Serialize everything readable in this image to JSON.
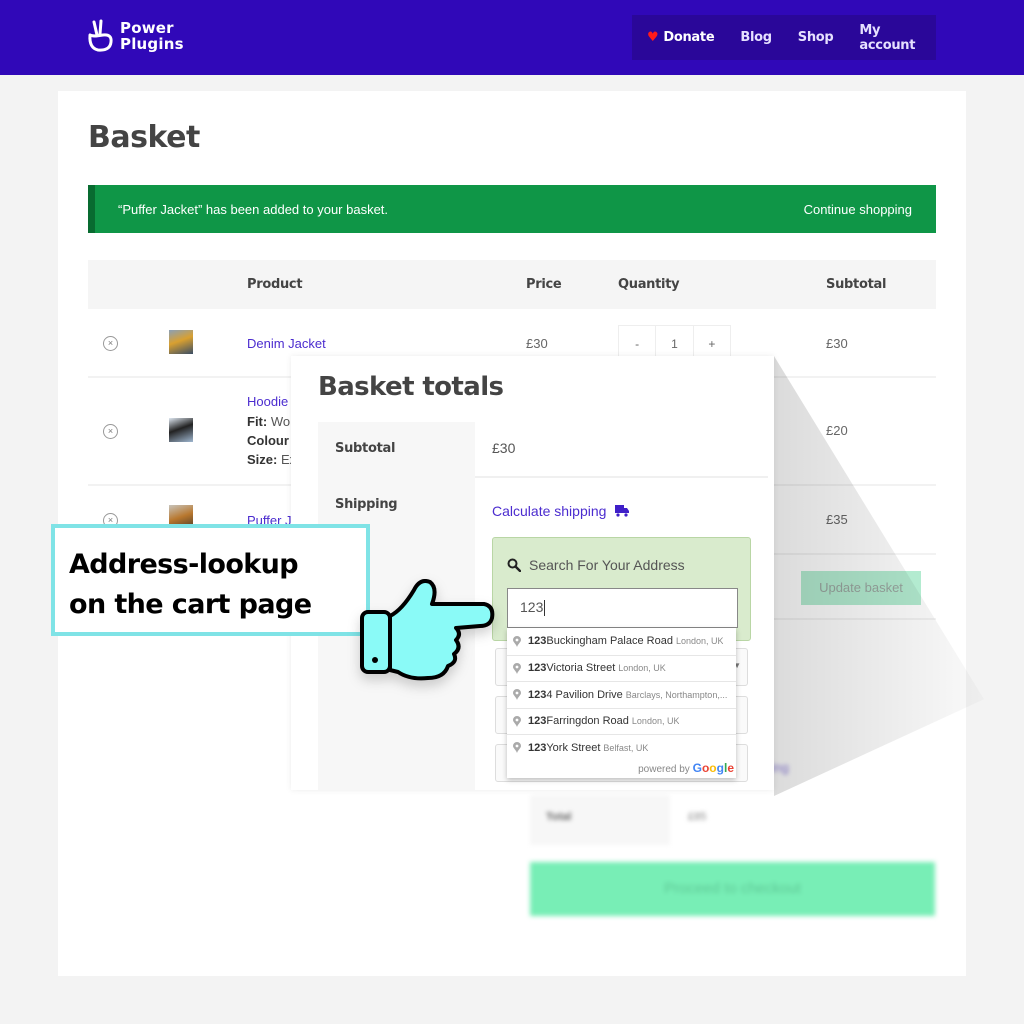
{
  "header": {
    "logo_line1": "Power",
    "logo_line2": "Plugins",
    "nav": [
      {
        "label": "Donate",
        "icon": "heart-icon"
      },
      {
        "label": "Blog"
      },
      {
        "label": "Shop"
      },
      {
        "label": "My account"
      }
    ]
  },
  "page": {
    "title": "Basket",
    "notice": {
      "message": "“Puffer Jacket” has been added to your basket.",
      "link": "Continue shopping"
    }
  },
  "cart": {
    "columns": [
      "Product",
      "Price",
      "Quantity",
      "Subtotal"
    ],
    "rows": [
      {
        "name": "Denim Jacket",
        "price": "£30",
        "qty": "1",
        "subtotal": "£30",
        "minus": "-",
        "plus": "+"
      },
      {
        "name": "Hoodie",
        "meta": [
          {
            "k": "Fit:",
            "v": "Wo"
          },
          {
            "k": "Colour",
            "v": ""
          },
          {
            "k": "Size:",
            "v": "Ex"
          }
        ],
        "subtotal": "£20"
      },
      {
        "name": "Puffer J",
        "subtotal": "£35"
      }
    ],
    "update_button": "Update basket",
    "remove_glyph": "×"
  },
  "totals_background": {
    "calculate_partial": "pping",
    "total_label": "Total",
    "total_value": "£85",
    "checkout_button": "Proceed to checkout"
  },
  "basket_totals": {
    "title": "Basket totals",
    "subtotal_label": "Subtotal",
    "subtotal_value": "£30",
    "shipping_label": "Shipping",
    "calculate_shipping": "Calculate shipping",
    "lookup": {
      "title": "Search For Your Address",
      "input_value": "123"
    },
    "suggestions": [
      {
        "match": "123",
        "rest": " Buckingham Palace Road",
        "secondary": "London, UK"
      },
      {
        "match": "123",
        "rest": " Victoria Street",
        "secondary": "London, UK"
      },
      {
        "match": "123",
        "rest": "4 Pavilion Drive",
        "secondary": "Barclays, Northampton,..."
      },
      {
        "match": "123",
        "rest": " Farringdon Road",
        "secondary": "London, UK"
      },
      {
        "match": "123",
        "rest": " York Street",
        "secondary": "Belfast, UK"
      }
    ],
    "powered_by": "powered by",
    "google": [
      "G",
      "o",
      "o",
      "g",
      "l",
      "e"
    ]
  },
  "callout": {
    "line1": "Address-lookup",
    "line2": "on the cart page"
  },
  "colors": {
    "header": "#3008b8",
    "notice": "#0f9647",
    "link": "#4b2ccf",
    "callout_border": "#7fe3e6",
    "hand": "#8afaf7",
    "checkout": "#78eeb6"
  }
}
